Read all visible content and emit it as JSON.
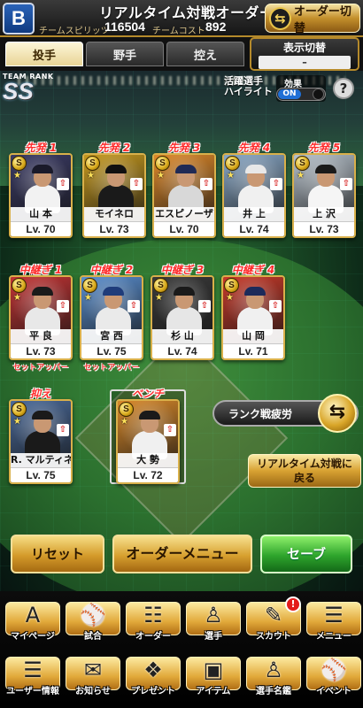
{
  "header": {
    "logo_text": "B",
    "title": "リアルタイム対戦オーダー",
    "team_spirits_label": "チームスピリッツ",
    "team_spirits_value": "116504",
    "team_cost_label": "チームコスト",
    "team_cost_value": "892",
    "order_switch_label": "オーダー切替"
  },
  "tabs": [
    {
      "label": "投手",
      "active": true
    },
    {
      "label": "野手",
      "active": false
    },
    {
      "label": "控え",
      "active": false
    }
  ],
  "display_switch": {
    "label": "表示切替",
    "value": "–"
  },
  "team_rank": {
    "label": "TEAM RANK",
    "value": "SS"
  },
  "highlight": {
    "label_line1": "活躍選手",
    "label_line2": "ハイライト",
    "effect_label": "効果",
    "effect_state": "ON"
  },
  "starters": [
    {
      "slot": "先発 1",
      "name": "山 本",
      "lv": "Lv. 70",
      "uniform": "#f2f2f2",
      "cap": "#1a1a2a",
      "bg": "#3b3b66"
    },
    {
      "slot": "先発 2",
      "name": "モイネロ",
      "lv": "Lv. 73",
      "uniform": "#1a1a1a",
      "cap": "#111111",
      "bg": "#c79a1f"
    },
    {
      "slot": "先発 3",
      "name": "エスピノーザ",
      "lv": "Lv. 70",
      "uniform": "#d8d8d8",
      "cap": "#202a55",
      "bg": "#e08a2a"
    },
    {
      "slot": "先発 4",
      "name": "井 上",
      "lv": "Lv. 74",
      "uniform": "#f0f0f0",
      "cap": "#e8e8e8",
      "bg": "#8aa9c8"
    },
    {
      "slot": "先発 5",
      "name": "上 沢",
      "lv": "Lv. 73",
      "uniform": "#f5f5f5",
      "cap": "#1a1a1a",
      "bg": "#b7c2cc"
    }
  ],
  "relievers": [
    {
      "slot": "中継ぎ 1",
      "name": "平 良",
      "lv": "Lv. 73",
      "role": "セットアッパー",
      "uniform": "#e8e8e8",
      "cap": "#1a1a1a",
      "bg": "#c43434"
    },
    {
      "slot": "中継ぎ 2",
      "name": "宮 西",
      "lv": "Lv. 75",
      "role": "セットアッパー",
      "uniform": "#eaeaea",
      "cap": "#1f3c7a",
      "bg": "#5a8fd0"
    },
    {
      "slot": "中継ぎ 3",
      "name": "杉 山",
      "lv": "Lv. 74",
      "role": "",
      "uniform": "#e6e6e6",
      "cap": "#1a1a1a",
      "bg": "#3a3a3a"
    },
    {
      "slot": "中継ぎ 4",
      "name": "山 岡",
      "lv": "Lv. 71",
      "role": "",
      "uniform": "#f0f0f0",
      "cap": "#1c2a5a",
      "bg": "#c93a2a"
    }
  ],
  "closer": {
    "slot": "抑え",
    "name": "R. マルティネス",
    "lv": "Lv. 75",
    "uniform": "#1a1a1a",
    "cap": "#1a1a1a",
    "bg": "#4a6a9a"
  },
  "bench": {
    "slot": "ベンチ",
    "name": "大 勢",
    "lv": "Lv. 72",
    "uniform": "#f0f0f0",
    "cap": "#1a1a1a",
    "bg": "#d9892a"
  },
  "rarity_mark": "S",
  "fatigue_label": "ランク戦疲労",
  "return_line1": "リアルタイム対戦に",
  "return_line2": "戻る",
  "actions": {
    "reset": "リセット",
    "order_menu": "オーダーメニュー",
    "save": "セーブ"
  },
  "nav_row1": [
    {
      "label": "マイページ",
      "icon": "mypage-icon",
      "glyph": "A"
    },
    {
      "label": "試合",
      "icon": "stadium-icon",
      "glyph": "⚾"
    },
    {
      "label": "オーダー",
      "icon": "order-icon",
      "glyph": "☷"
    },
    {
      "label": "選手",
      "icon": "player-icon",
      "glyph": "♙"
    },
    {
      "label": "スカウト",
      "icon": "scout-icon",
      "glyph": "✎",
      "badge": "!"
    },
    {
      "label": "メニュー",
      "icon": "menu-icon",
      "glyph": "☰"
    }
  ],
  "nav_row2": [
    {
      "label": "ユーザー情報",
      "icon": "user-info-icon",
      "glyph": "☰"
    },
    {
      "label": "お知らせ",
      "icon": "news-icon",
      "glyph": "✉"
    },
    {
      "label": "プレゼント",
      "icon": "present-icon",
      "glyph": "❖"
    },
    {
      "label": "アイテム",
      "icon": "item-icon",
      "glyph": "▣"
    },
    {
      "label": "選手名鑑",
      "icon": "player-directory-icon",
      "glyph": "♙"
    },
    {
      "label": "イベント",
      "icon": "event-icon",
      "glyph": "⚾"
    }
  ]
}
